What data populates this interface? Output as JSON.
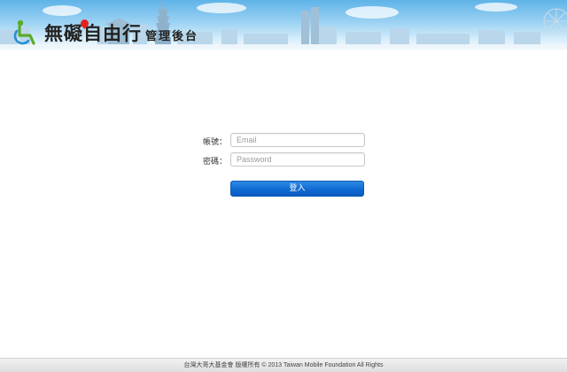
{
  "header": {
    "logo_main": "無礙自由行",
    "logo_sub": "管理後台",
    "logo_icon": "wheelchair-icon"
  },
  "login": {
    "account_label": "帳號：",
    "email_placeholder": "Email",
    "email_value": "",
    "password_label": "密碼：",
    "password_placeholder": "Password",
    "password_value": "",
    "submit_label": "登入"
  },
  "footer": {
    "copyright": "台灣大哥大基金會 版權所有 © 2013 Taiwan Mobile Foundation All Rights"
  },
  "colors": {
    "button_blue": "#0f6ad2",
    "sky": "#5fb3e8",
    "accent_green": "#5cab2a",
    "pin_red": "#e2231a"
  }
}
